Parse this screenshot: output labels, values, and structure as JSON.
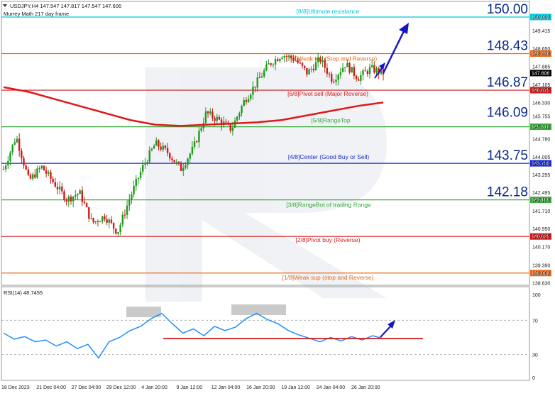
{
  "header": {
    "symbol_line": "USDJPY,H4  147.547 147.817 147.547 147.606",
    "indicator_line": "Murrey Math 217 day frame"
  },
  "rsi": {
    "label": "RSI(14) 48.7455",
    "ticks": [
      "100",
      "70",
      "30",
      "0"
    ]
  },
  "colors": {
    "background": "#ffffff",
    "bull_candle": "#1e9a1e",
    "bear_candle": "#d11a1a",
    "ma_line": "#e01818",
    "rsi_line": "#1e90ff",
    "arrow": "#1515c8",
    "overbought_box": "#bdbdbd"
  },
  "chart_data": {
    "type": "line",
    "title": "USDJPY,H4",
    "price_axis_ticks": [
      "150.000",
      "149.415",
      "148.438",
      "148.650",
      "147.606",
      "147.885",
      "147.105",
      "146.875",
      "146.330",
      "145.755",
      "145.312",
      "144.780",
      "144.005",
      "143.750",
      "143.255",
      "142.495",
      "142.188",
      "141.710",
      "140.950",
      "140.625",
      "140.170",
      "139.390",
      "139.062",
      "138.630"
    ],
    "x_labels": [
      "18 Dec 2023",
      "21 Dec 04:00",
      "27 Dec 04:00",
      "29 Dec 12:00",
      "4 Jan 20:00",
      "9 Jan 12:00",
      "12 Jan 04:00",
      "16 Jan 20:00",
      "19 Jan 12:00",
      "24 Jan 04:00",
      "26 Jan 20:00"
    ],
    "last_price": 147.606,
    "murrey_levels": [
      {
        "label": "[8/8]Ultimate resistance",
        "value": 150.0,
        "big": "150.00",
        "tag": "150.000",
        "color": "#00c8e0"
      },
      {
        "label": "[7/8]Weak top (Stop and Reverse)",
        "value": 148.438,
        "big": "148.43",
        "tag": "148.438",
        "color": "#e86a1a"
      },
      {
        "label": "[6/8]Pivot sell (Major Reverse)",
        "value": 146.875,
        "big": "146.87",
        "tag": "146.875",
        "color": "#d11a1a"
      },
      {
        "label": "[5/8]RangeTop",
        "value": 145.312,
        "big": "146.09",
        "tag": "145.312",
        "color": "#3aa83a"
      },
      {
        "label": "[4/8]Center (Good Buy or Sell)",
        "value": 143.75,
        "big": "143.75",
        "tag": "143.750",
        "color": "#1a2ad1"
      },
      {
        "label": "[3/8]RangeBot of trading Range",
        "value": 142.188,
        "big": "142.18",
        "tag": "142.188",
        "color": "#3aa83a"
      },
      {
        "label": "[2/8]Pivot buy (Reverse)",
        "value": 140.625,
        "big": "",
        "tag": "140.625",
        "color": "#d11a1a"
      },
      {
        "label": "[1/8]Weak sup (stop and Reverse)",
        "value": 139.062,
        "big": "",
        "tag": "139.062",
        "color": "#e86a1a"
      }
    ],
    "ma_series": {
      "values": [
        147.0,
        146.8,
        146.5,
        146.2,
        145.9,
        145.6,
        145.4,
        145.35,
        145.4,
        145.45,
        145.5,
        145.6,
        145.8,
        146.0,
        146.2,
        146.35
      ]
    },
    "price_series": {
      "values": [
        143.5,
        144.9,
        143.0,
        143.6,
        142.9,
        142.2,
        142.5,
        141.2,
        141.5,
        140.8,
        142.3,
        143.6,
        144.6,
        144.2,
        143.5,
        144.4,
        145.9,
        145.6,
        145.2,
        146.4,
        147.2,
        148.0,
        148.4,
        148.2,
        147.6,
        148.2,
        147.3,
        148.0,
        147.4,
        147.8,
        147.6
      ]
    },
    "rsi_series": {
      "values": [
        55,
        48,
        51,
        45,
        47,
        40,
        45,
        37,
        42,
        26,
        45,
        50,
        58,
        63,
        72,
        78,
        66,
        55,
        60,
        52,
        63,
        58,
        62,
        72,
        78,
        71,
        66,
        58,
        53,
        49,
        45,
        50,
        46,
        51,
        47,
        52,
        48.7
      ]
    },
    "rsi_levels": [
      70,
      30
    ]
  }
}
